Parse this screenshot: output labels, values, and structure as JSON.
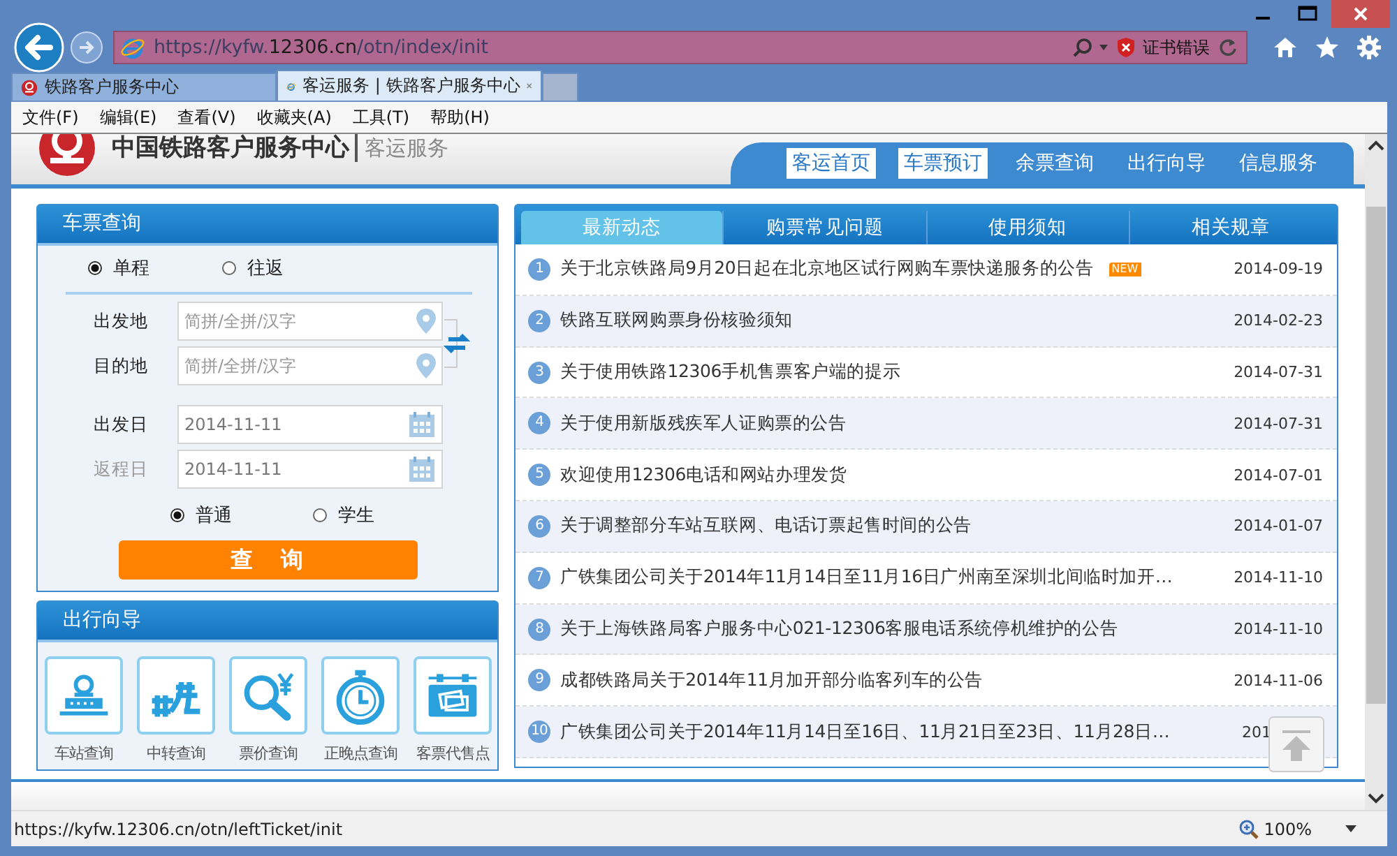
{
  "browser": {
    "address_prefix": "https://kyfw.",
    "address_domain": "12306.cn",
    "address_path": "/otn/index/init",
    "cert_error": "证书错误",
    "tabs": [
      {
        "title": "铁路客户服务中心",
        "selected": false
      },
      {
        "title": "客运服务 | 铁路客户服务中心",
        "selected": true
      }
    ],
    "menu": [
      "文件(F)",
      "编辑(E)",
      "查看(V)",
      "收藏夹(A)",
      "工具(T)",
      "帮助(H)"
    ]
  },
  "header": {
    "site_title": "中国铁路客户服务中心",
    "subtitle": "客运服务",
    "nav": [
      {
        "label": "客运首页",
        "highlighted": true
      },
      {
        "label": "车票预订",
        "highlighted": true
      },
      {
        "label": "余票查询",
        "highlighted": false
      },
      {
        "label": "出行向导",
        "highlighted": false
      },
      {
        "label": "信息服务",
        "highlighted": false
      }
    ]
  },
  "ticket_search": {
    "title": "车票查询",
    "trip_types": [
      {
        "label": "单程",
        "selected": true
      },
      {
        "label": "往返",
        "selected": false
      }
    ],
    "fields": [
      {
        "kind": "station",
        "label": "出发地",
        "placeholder": "简拼/全拼/汉字",
        "disabled": false
      },
      {
        "kind": "station",
        "label": "目的地",
        "placeholder": "简拼/全拼/汉字",
        "disabled": false
      },
      {
        "kind": "date",
        "label": "出发日",
        "value": "2014-11-11",
        "disabled": false
      },
      {
        "kind": "date",
        "label": "返程日",
        "value": "2014-11-11",
        "disabled": true
      }
    ],
    "passenger_types": [
      {
        "label": "普通",
        "selected": true
      },
      {
        "label": "学生",
        "selected": false
      }
    ],
    "button": "查　询"
  },
  "guide": {
    "title": "出行向导",
    "items": [
      "车站查询",
      "中转查询",
      "票价查询",
      "正晚点查询",
      "客票代售点"
    ]
  },
  "news": {
    "tabs": [
      {
        "label": "最新动态",
        "selected": true
      },
      {
        "label": "购票常见问题",
        "selected": false
      },
      {
        "label": "使用须知",
        "selected": false
      },
      {
        "label": "相关规章",
        "selected": false
      }
    ],
    "items": [
      {
        "number": "1",
        "title": "关于北京铁路局9月20日起在北京地区试行网购车票快递服务的公告",
        "badge": "NEW",
        "date": "2014-09-19"
      },
      {
        "number": "2",
        "title": "铁路互联网购票身份核验须知",
        "date": "2014-02-23"
      },
      {
        "number": "3",
        "title": "关于使用铁路12306手机售票客户端的提示",
        "date": "2014-07-31"
      },
      {
        "number": "4",
        "title": "关于使用新版残疾军人证购票的公告",
        "date": "2014-07-31"
      },
      {
        "number": "5",
        "title": "欢迎使用12306电话和网站办理发货",
        "date": "2014-07-01"
      },
      {
        "number": "6",
        "title": "关于调整部分车站互联网、电话订票起售时间的公告",
        "date": "2014-01-07"
      },
      {
        "number": "7",
        "title": "广铁集团公司关于2014年11月14日至11月16日广州南至深圳北间临时加开…",
        "date": "2014-11-10"
      },
      {
        "number": "8",
        "title": "关于上海铁路局客户服务中心021-12306客服电话系统停机维护的公告",
        "date": "2014-11-10"
      },
      {
        "number": "9",
        "title": "成都铁路局关于2014年11月加开部分临客列车的公告",
        "date": "2014-11-06"
      },
      {
        "number": "10",
        "title": "广铁集团公司关于2014年11月14日至16日、11月21日至23日、11月28日…",
        "date": "201"
      }
    ]
  },
  "status_bar": {
    "url": "https://kyfw.12306.cn/otn/leftTicket/init",
    "zoom": "100%"
  }
}
